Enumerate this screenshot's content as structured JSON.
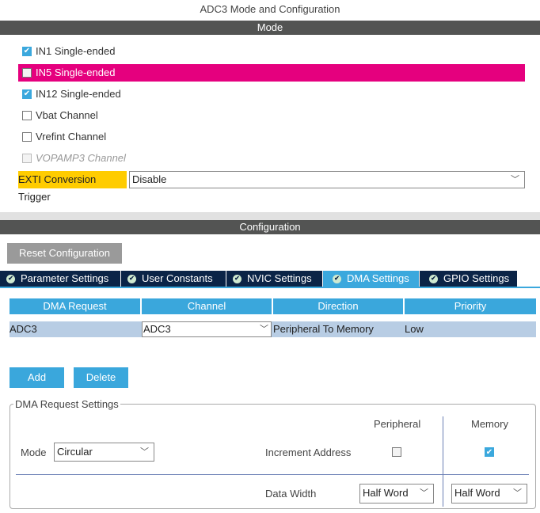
{
  "title": "ADC3 Mode and Configuration",
  "mode_header": "Mode",
  "channels": [
    {
      "label": "IN1 Single-ended",
      "checked": true
    },
    {
      "label": "IN5 Single-ended",
      "checked": false,
      "highlighted": true
    },
    {
      "label": "IN12 Single-ended",
      "checked": true
    },
    {
      "label": "Vbat Channel",
      "checked": false
    },
    {
      "label": "Vrefint Channel",
      "checked": false
    },
    {
      "label": "VOPAMP3 Channel",
      "checked": false,
      "disabled": true
    }
  ],
  "exti": {
    "label": "EXTI Conversion Trigger",
    "value": "Disable"
  },
  "config_header": "Configuration",
  "reset_button": "Reset Configuration",
  "tabs": [
    "Parameter Settings",
    "User Constants",
    "NVIC Settings",
    "DMA Settings",
    "GPIO Settings"
  ],
  "active_tab": "DMA Settings",
  "table": {
    "headers": [
      "DMA Request",
      "Channel",
      "Direction",
      "Priority"
    ],
    "rows": [
      {
        "request": "ADC3",
        "channel": "ADC3",
        "direction": "Peripheral To Memory",
        "priority": "Low"
      }
    ]
  },
  "add_button": "Add",
  "delete_button": "Delete",
  "settings": {
    "legend": "DMA Request Settings",
    "mode_label": "Mode",
    "mode_value": "Circular",
    "peripheral": "Peripheral",
    "memory": "Memory",
    "increment_label": "Increment Address",
    "increment_peripheral": false,
    "increment_memory": true,
    "data_width_label": "Data Width",
    "data_width_peripheral": "Half Word",
    "data_width_memory": "Half Word"
  },
  "colors": {
    "highlight": "#e5007e",
    "accent": "#3aa7dc",
    "tab_bg": "#0b2447",
    "exti_bg": "#ffcc00"
  }
}
